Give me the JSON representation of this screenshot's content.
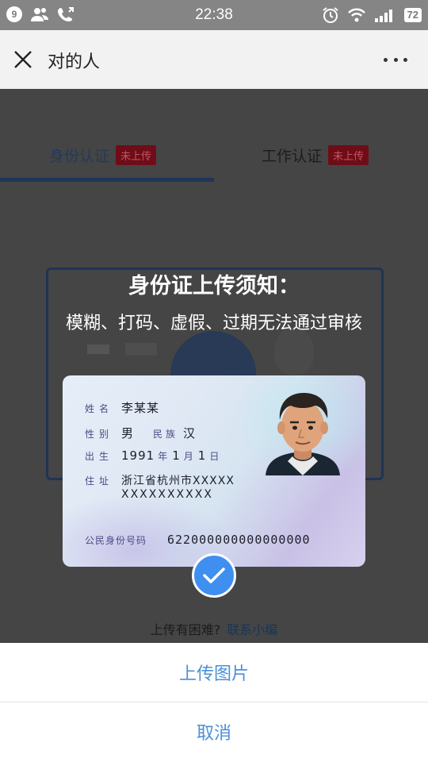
{
  "status_bar": {
    "notification_count": "9",
    "time": "22:38",
    "battery": "72"
  },
  "nav": {
    "title": "对的人"
  },
  "tabs": [
    {
      "label": "身份认证",
      "badge": "未上传",
      "active": true
    },
    {
      "label": "工作认证",
      "badge": "未上传",
      "active": false
    }
  ],
  "notice": {
    "title": "身份证上传须知：",
    "subtitle": "模糊、打码、虚假、过期无法通过审核"
  },
  "id_card": {
    "name_label": "姓名",
    "name": "李某某",
    "gender_label": "性别",
    "gender": "男",
    "ethnicity_label": "民族",
    "ethnicity": "汉",
    "birth_label": "出生",
    "birth_year": "1991",
    "year_unit": "年",
    "birth_month": "1",
    "month_unit": "月",
    "birth_day": "1",
    "day_unit": "日",
    "address_label": "住址",
    "address_line1": "浙江省杭州市XXXXX",
    "address_line2": "XXXXXXXXXX",
    "id_number_label": "公民身份号码",
    "id_number": "622000000000000000"
  },
  "help": {
    "text": "上传有困难?",
    "link": "联系小编"
  },
  "action_sheet": {
    "upload_label": "上传图片",
    "cancel_label": "取消"
  },
  "colors": {
    "accent_blue": "#4a90d9",
    "check_blue": "#3f8ff0",
    "badge_red": "#6e0d17",
    "tab_active": "#203657"
  },
  "icons": [
    "close-icon",
    "more-icon",
    "check-icon",
    "wifi-icon",
    "signal-icon",
    "alarm-icon",
    "contacts-icon",
    "phone-icon"
  ]
}
